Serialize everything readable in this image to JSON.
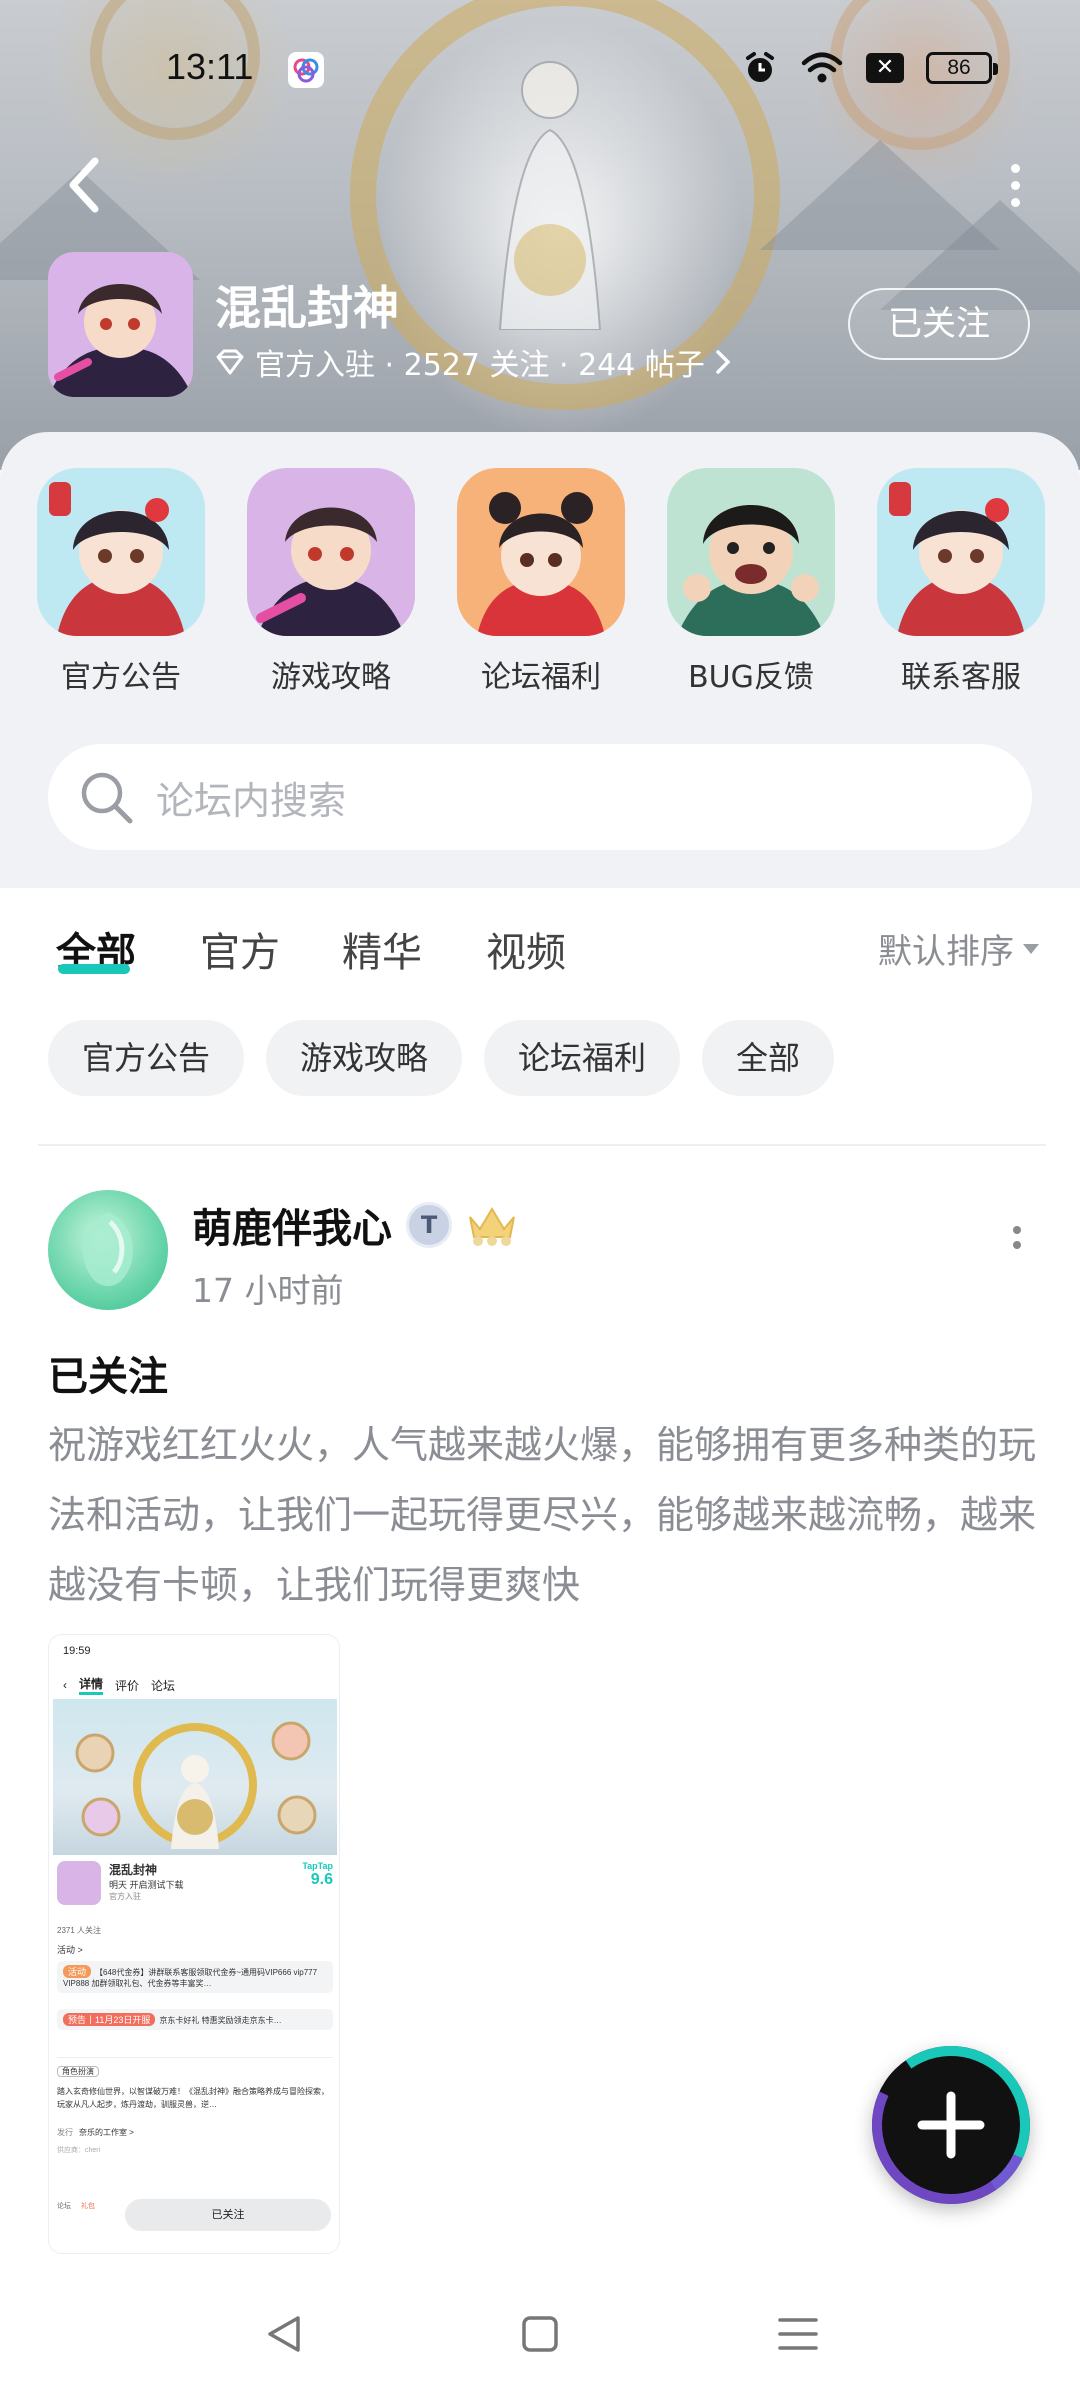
{
  "status_bar": {
    "time": "13:11",
    "battery": "86",
    "icons": [
      "alarm-icon",
      "wifi-icon",
      "sim-off-icon",
      "battery-icon"
    ]
  },
  "header": {
    "forum_name": "混乱封神",
    "meta": "官方入驻 · 2527 关注 · 244 帖子",
    "follow_label": "已关注",
    "meta_icon": "diamond-icon"
  },
  "quick_links": [
    {
      "label": "官方公告"
    },
    {
      "label": "游戏攻略"
    },
    {
      "label": "论坛福利"
    },
    {
      "label": "BUG反馈"
    },
    {
      "label": "联系客服"
    }
  ],
  "search": {
    "placeholder": "论坛内搜索"
  },
  "tabs": [
    {
      "label": "全部",
      "active": true
    },
    {
      "label": "官方"
    },
    {
      "label": "精华"
    },
    {
      "label": "视频"
    }
  ],
  "sort": {
    "label": "默认排序"
  },
  "chips": [
    "官方公告",
    "游戏攻略",
    "论坛福利",
    "全部"
  ],
  "post": {
    "author": "萌鹿伴我心",
    "badge": "T",
    "time": "17 小时前",
    "title": "已关注",
    "body": "祝游戏红红火火，人气越来越火爆，能够拥有更多种类的玩法和活动，让我们一起玩得更尽兴，能够越来越流畅，越来越没有卡顿，让我们玩得更爽快",
    "image": {
      "time": "19:59",
      "nav": [
        "详情",
        "评价",
        "论坛"
      ],
      "game_name": "混乱封神",
      "game_sub": "明天 开启测试下载",
      "official": "官方入驻",
      "rating_brand": "TapTap",
      "rating": "9.6",
      "followers": "2371 人关注",
      "activity_label": "活动 >",
      "act1_tag": "活动",
      "act1_text": "【648代金券】讲群联系客服领取代金券~通用码VIP666 vip777 VIP888 加群领取礼包、代金券等丰富奖…",
      "act2_tag": "预告丨11月23日开服",
      "act2_text": "京东卡好礼 特惠奖励领走京东卡…",
      "genre_tag": "角色扮演",
      "desc": "踏入玄奇修仙世界，以智谋破万难！《混乱封神》融合策略养成与冒险探索，玩家从凡人起步，炼丹渡劫，驯服灵兽，逆…",
      "publisher_label": "发行",
      "publisher": "奈乐的工作室 >",
      "vendor": "供应商：cheri",
      "bottom_left1": "论坛",
      "bottom_left2": "礼包",
      "follow_btn": "已关注"
    }
  },
  "nav_bar": {
    "icons": [
      "back-triangle-icon",
      "home-square-icon",
      "menu-lines-icon"
    ]
  }
}
